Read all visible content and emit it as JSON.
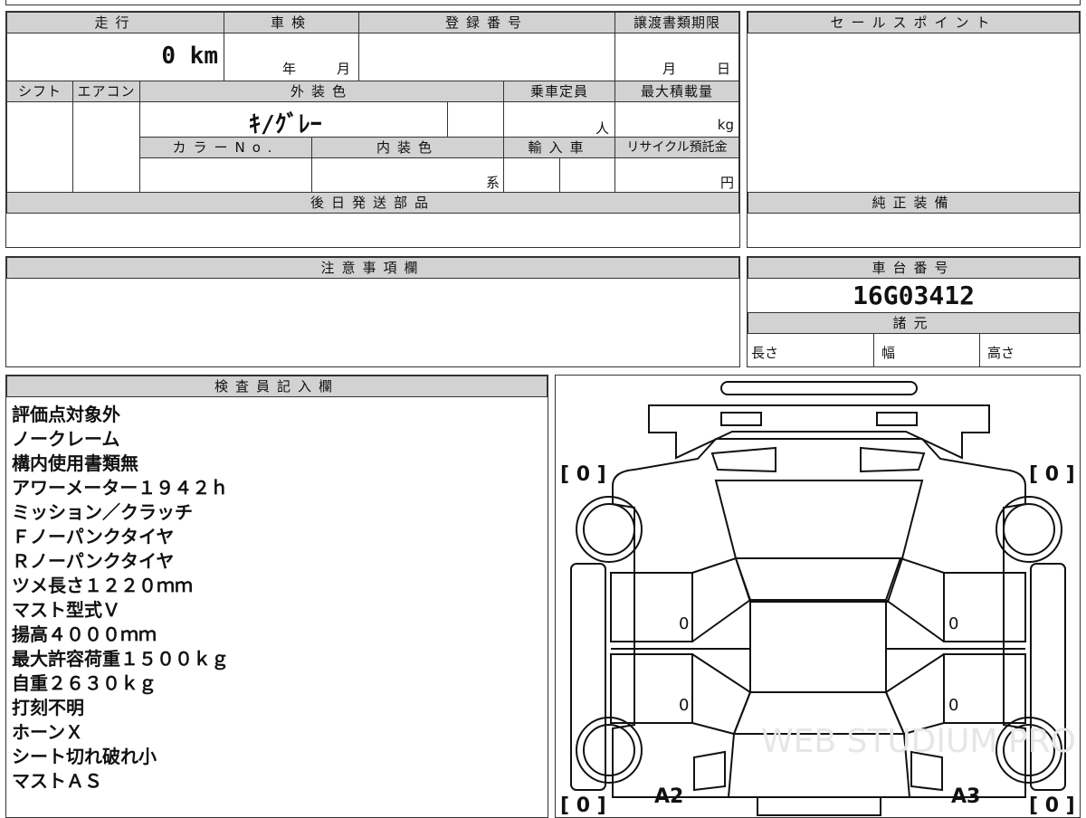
{
  "vehicle_info": {
    "mileage_label": "走行",
    "mileage_value": "0 km",
    "inspection_label": "車検",
    "inspection_year_unit": "年",
    "inspection_month_unit": "月",
    "registration_label": "登録番号",
    "transfer_label": "譲渡書類期限",
    "transfer_month_unit": "月",
    "transfer_day_unit": "日",
    "shift_label": "シフト",
    "aircon_label": "エアコン",
    "exterior_color_label": "外装色",
    "exterior_color_value": "ｷ/ｸﾞﾚｰ",
    "capacity_label": "乗車定員",
    "capacity_unit": "人",
    "max_load_label": "最大積載量",
    "max_load_unit": "kg",
    "color_no_label": "カラーNo.",
    "interior_color_label": "内装色",
    "interior_color_unit": "系",
    "import_label": "輸入車",
    "recycle_label": "リサイクル預託金",
    "recycle_unit": "円",
    "later_parts_label": "後日発送部品"
  },
  "sale_points": {
    "label": "セールスポイント"
  },
  "genuine_equipment": {
    "label": "純正装備"
  },
  "caution": {
    "label": "注意事項欄"
  },
  "chassis": {
    "label": "車台番号",
    "number": "16G03412"
  },
  "specs": {
    "label": "諸元",
    "length_label": "長さ",
    "width_label": "幅",
    "height_label": "高さ"
  },
  "inspector": {
    "label": "検査員記入欄",
    "notes": [
      "評価点対象外",
      "ノークレーム",
      "構内使用書類無",
      "アワーメーター１９４２ｈ",
      "ミッション／クラッチ",
      "Ｆノーパンクタイヤ",
      "Ｒノーパンクタイヤ",
      "ツメ長さ１２２０ｍｍ",
      "マスト型式Ｖ",
      "揚高４０００ｍｍ",
      "最大許容荷重１５００ｋｇ",
      "自重２６３０ｋｇ",
      "打刻不明",
      "ホーンＸ",
      "シート切れ破れ小",
      "マストＡＳ"
    ]
  },
  "diagram": {
    "tire_front_left": "[ 0 ]",
    "tire_front_right": "[ 0 ]",
    "tire_rear_left": "[ 0 ]",
    "tire_rear_right": "[ 0 ]",
    "panel_left_upper": "0",
    "panel_right_upper": "0",
    "panel_left_lower": "0",
    "panel_right_lower": "0",
    "mark_a2": "A2",
    "mark_a3": "A3",
    "watermark": "WEB STUDIUM PRO"
  }
}
